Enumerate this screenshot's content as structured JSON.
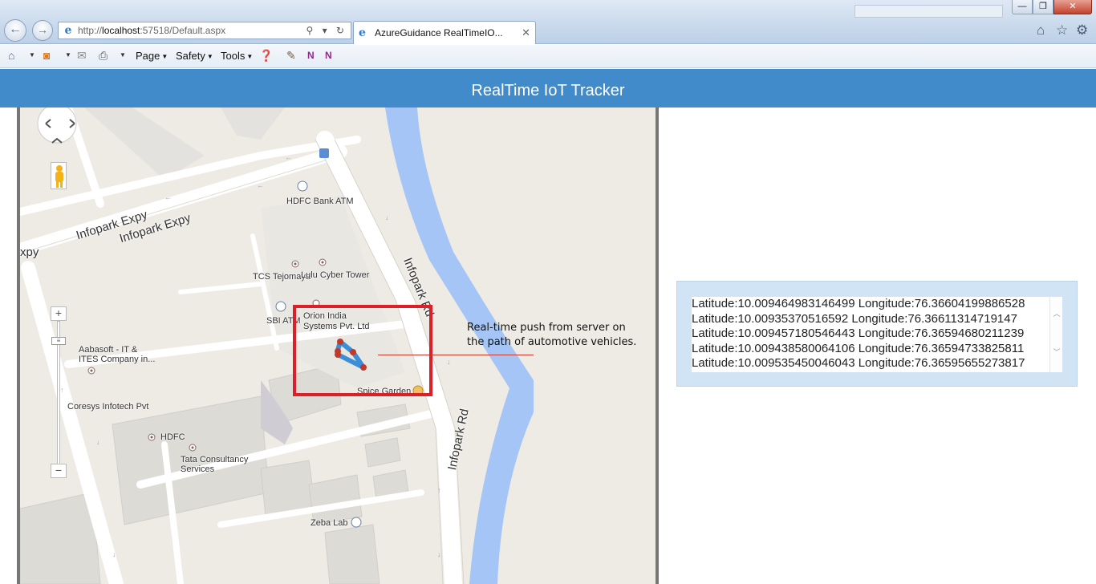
{
  "browser": {
    "url_prefix": "http://",
    "url_host": "localhost",
    "url_rest": ":57518/Default.aspx",
    "tab_title": "AzureGuidance RealTimeIO...",
    "tab_close": "✕",
    "address_tools": "⚲ ▾ ↻"
  },
  "window_controls": {
    "minimize": "—",
    "maximize": "❐",
    "close": "✕"
  },
  "command_bar": {
    "menus": [
      "Page",
      "Safety",
      "Tools"
    ]
  },
  "header": {
    "title": "RealTime IoT Tracker"
  },
  "map": {
    "labels": {
      "hdfc_bank_atm": "HDFC Bank ATM",
      "tcs": "TCS Tejomaya",
      "lulu": "Lulu Cyber Tower",
      "sbi_atm": "SBI ATM",
      "orion": "Orion India\nSystems Pvt. Ltd",
      "aabasoft": "Aabasoft - IT &\nITES Company in...",
      "coresys": "Coresys Infotech Pvt",
      "hdfc": "HDFC",
      "tata": "Tata Consultancy\nServices",
      "spice": "Spice Garden",
      "zeba": "Zeba Lab",
      "infopark_expy_1": "Infopark Expy",
      "infopark_expy_2": "Infopark Expy",
      "infopark_rd_1": "Infopark Rd",
      "infopark_rd_2": "Infopark Rd",
      "xpy": "xpy",
      "atm": "ATM"
    },
    "callout": "Real-time push from server on the path of automotive vehicles.",
    "zoom_in": "+",
    "zoom_out": "−"
  },
  "coordinates": [
    "Latitude:10.009464983146499 Longitude:76.36604199886528",
    "Latitude:10.00935370516592 Longitude:76.36611314719147",
    "Latitude:10.009457180546443 Longitude:76.36594680211239",
    "Latitude:10.009438580064106 Longitude:76.36594733825811",
    "Latitude:10.009535450046043 Longitude:76.36595655273817"
  ],
  "colors": {
    "header_bg": "#428bca",
    "panel_bg": "#d1e4f5",
    "highlight": "#dd2027",
    "river": "#a4c5f5",
    "vehicle_path": "#3b8fd6"
  }
}
